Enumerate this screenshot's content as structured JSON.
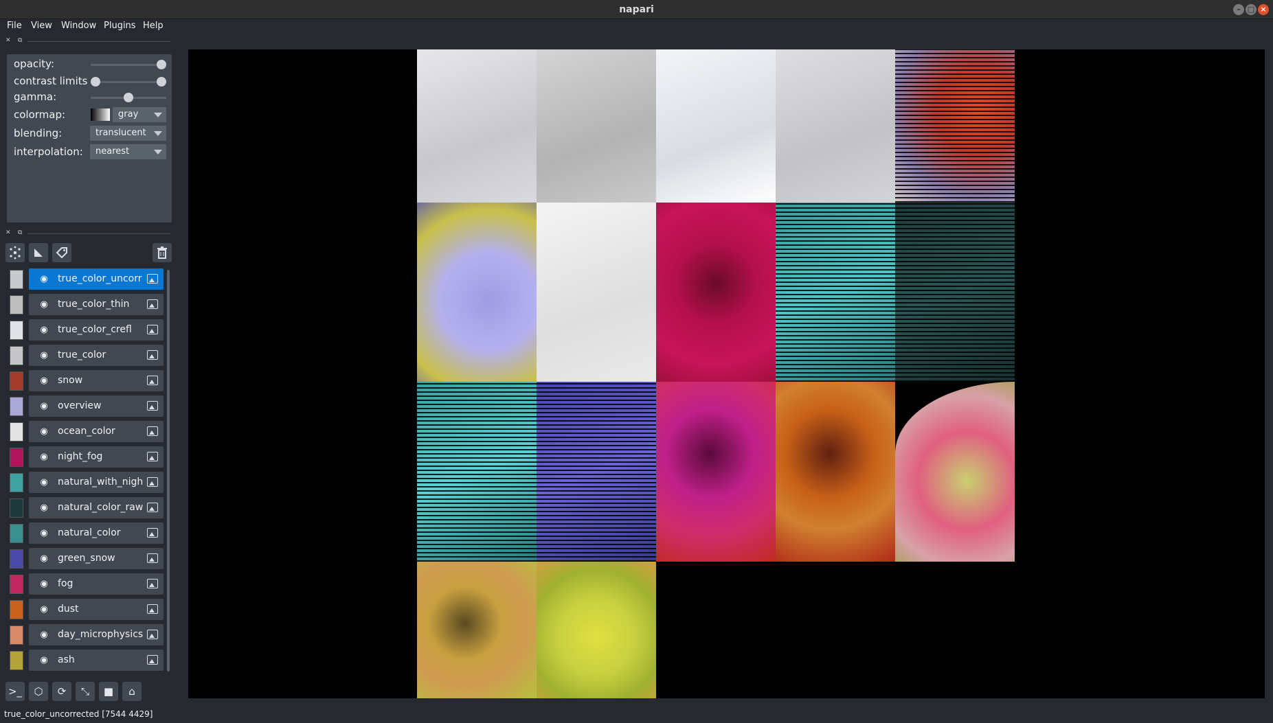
{
  "window": {
    "title": "napari"
  },
  "menu": [
    "File",
    "View",
    "Window",
    "Plugins",
    "Help"
  ],
  "controls": {
    "opacity_label": "opacity:",
    "opacity": 1.0,
    "contrast_label": "contrast limits",
    "contrast_low": 0.0,
    "contrast_high": 1.0,
    "gamma_label": "gamma:",
    "gamma": 0.5,
    "colormap_label": "colormap:",
    "colormap": "gray",
    "blending_label": "blending:",
    "blending": "translucent",
    "interpolation_label": "interpolation:",
    "interpolation": "nearest"
  },
  "layers": [
    {
      "name": "true_color_uncorr",
      "selected": true,
      "thumb": "#c8c9cc"
    },
    {
      "name": "true_color_thin",
      "selected": false,
      "thumb": "#bdbdbd"
    },
    {
      "name": "true_color_crefl",
      "selected": false,
      "thumb": "#dfe2e6"
    },
    {
      "name": "true_color",
      "selected": false,
      "thumb": "#c6c6c8"
    },
    {
      "name": "snow",
      "selected": false,
      "thumb": "#a33a2a"
    },
    {
      "name": "overview",
      "selected": false,
      "thumb": "#a9a8d6"
    },
    {
      "name": "ocean_color",
      "selected": false,
      "thumb": "#e4e4e4"
    },
    {
      "name": "night_fog",
      "selected": false,
      "thumb": "#b0145a"
    },
    {
      "name": "natural_with_nigh",
      "selected": false,
      "thumb": "#3fa0a0"
    },
    {
      "name": "natural_color_raw",
      "selected": false,
      "thumb": "#1e3a3a"
    },
    {
      "name": "natural_color",
      "selected": false,
      "thumb": "#3a8f8f"
    },
    {
      "name": "green_snow",
      "selected": false,
      "thumb": "#4b4aa8"
    },
    {
      "name": "fog",
      "selected": false,
      "thumb": "#c0285e"
    },
    {
      "name": "dust",
      "selected": false,
      "thumb": "#c8621c"
    },
    {
      "name": "day_microphysics",
      "selected": false,
      "thumb": "#d98a6a"
    },
    {
      "name": "ash",
      "selected": false,
      "thumb": "#b6a43a"
    }
  ],
  "icons": {
    "points": "points-icon",
    "shapes": "shapes-icon",
    "labels": "labels-icon",
    "delete": "trash-icon"
  },
  "status": "true_color_uncorrected [7544 4429]"
}
